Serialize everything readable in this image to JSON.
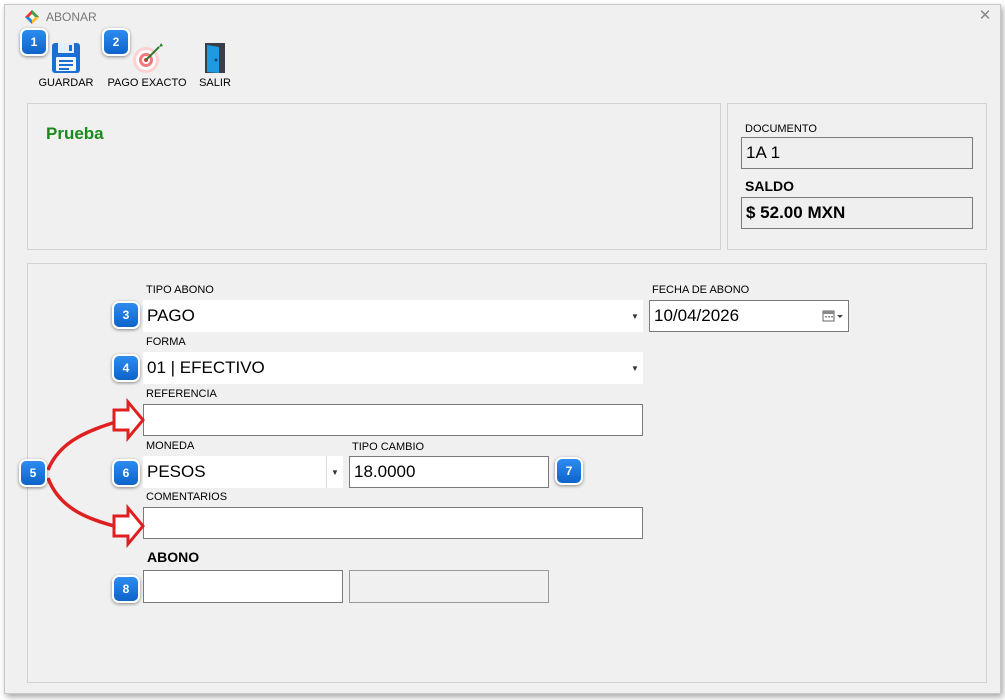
{
  "window": {
    "title": "ABONAR"
  },
  "toolbar": {
    "save_label": "GUARDAR",
    "exact_pay_label": "PAGO EXACTO",
    "exit_label": "SALIR"
  },
  "client": {
    "name": "Prueba"
  },
  "document": {
    "label": "DOCUMENTO",
    "value": "1A 1",
    "balance_label": "SALDO",
    "balance_value": "$ 52.00 MXN"
  },
  "form": {
    "tipo_abono_label": "TIPO ABONO",
    "tipo_abono_value": "PAGO",
    "fecha_label": "FECHA DE ABONO",
    "fecha_value": "10/04/2026",
    "forma_label": "FORMA",
    "forma_value": "01 | EFECTIVO",
    "referencia_label": "REFERENCIA",
    "referencia_value": "",
    "moneda_label": "MONEDA",
    "moneda_value": "PESOS",
    "tipo_cambio_label": "TIPO CAMBIO",
    "tipo_cambio_value": "18.0000",
    "comentarios_label": "COMENTARIOS",
    "comentarios_value": "",
    "abono_label": "ABONO",
    "abono_value": "",
    "abono_converted_value": ""
  },
  "badges": [
    "1",
    "2",
    "3",
    "4",
    "5",
    "6",
    "7",
    "8"
  ],
  "colors": {
    "badge": "#1e78e0",
    "client_name": "#1a8a1a",
    "arrow": "#e02020"
  },
  "icons": {
    "logo": "app-logo-icon",
    "save": "floppy-disk-icon",
    "exact_pay": "target-icon",
    "exit": "door-exit-icon",
    "calendar": "calendar-icon",
    "dropdown": "chevron-down-icon",
    "close": "close-icon"
  }
}
